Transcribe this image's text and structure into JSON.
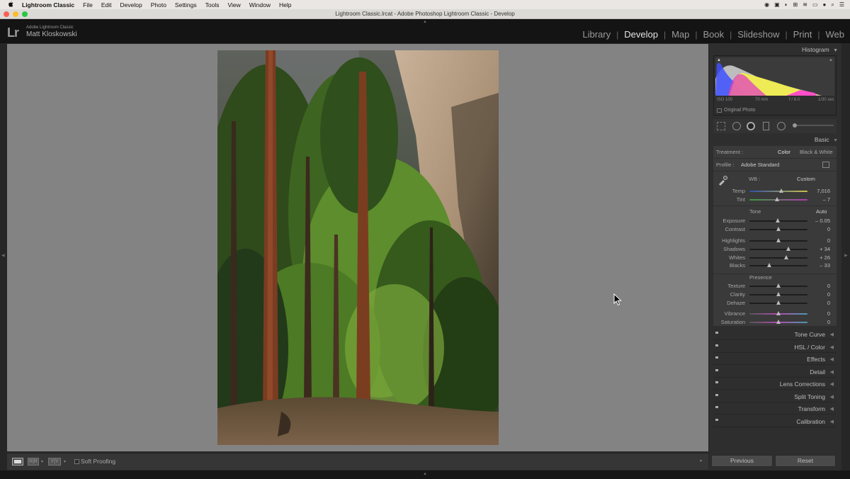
{
  "menubar": {
    "app": "Lightroom Classic",
    "items": [
      "File",
      "Edit",
      "Develop",
      "Photo",
      "Settings",
      "Tools",
      "View",
      "Window",
      "Help"
    ]
  },
  "window": {
    "title": "Lightroom Classic.lrcat - Adobe Photoshop Lightroom Classic - Develop"
  },
  "identity": {
    "logo": "Lr",
    "product": "Adobe Lightroom Classic",
    "user": "Matt Kloskowski"
  },
  "modules": [
    "Library",
    "Develop",
    "Map",
    "Book",
    "Slideshow",
    "Print",
    "Web"
  ],
  "active_module": "Develop",
  "histogram": {
    "title": "Histogram",
    "iso": "ISO 100",
    "focal": "70 mm",
    "aperture": "f / 8.0",
    "shutter": "1/30 sec",
    "original_label": "Original Photo"
  },
  "basic": {
    "title": "Basic",
    "treatment_label": "Treatment :",
    "treatment_color": "Color",
    "treatment_bw": "Black & White",
    "profile_label": "Profile :",
    "profile_value": "Adobe Standard",
    "wb_label": "WB :",
    "wb_value": "Custom",
    "tone_label": "Tone",
    "auto_label": "Auto",
    "presence_label": "Presence",
    "sliders": [
      {
        "label": "Temp",
        "value": "7,016",
        "pos": 0.55
      },
      {
        "label": "Tint",
        "value": "– 7",
        "pos": 0.48
      },
      {
        "label": "Exposure",
        "value": "– 0.05",
        "pos": 0.49
      },
      {
        "label": "Contrast",
        "value": "0",
        "pos": 0.5
      },
      {
        "label": "Highlights",
        "value": "0",
        "pos": 0.5
      },
      {
        "label": "Shadows",
        "value": "+ 34",
        "pos": 0.67
      },
      {
        "label": "Whites",
        "value": "+ 26",
        "pos": 0.63
      },
      {
        "label": "Blacks",
        "value": "– 33",
        "pos": 0.34
      },
      {
        "label": "Texture",
        "value": "0",
        "pos": 0.5
      },
      {
        "label": "Clarity",
        "value": "0",
        "pos": 0.5
      },
      {
        "label": "Dehaze",
        "value": "0",
        "pos": 0.5
      },
      {
        "label": "Vibrance",
        "value": "0",
        "pos": 0.5
      },
      {
        "label": "Saturation",
        "value": "0",
        "pos": 0.5
      }
    ]
  },
  "panels": [
    "Tone Curve",
    "HSL / Color",
    "Effects",
    "Detail",
    "Lens Corrections",
    "Split Toning",
    "Transform",
    "Calibration"
  ],
  "toolbar": {
    "soft_proofing": "Soft Proofing"
  },
  "buttons": {
    "previous": "Previous",
    "reset": "Reset"
  }
}
